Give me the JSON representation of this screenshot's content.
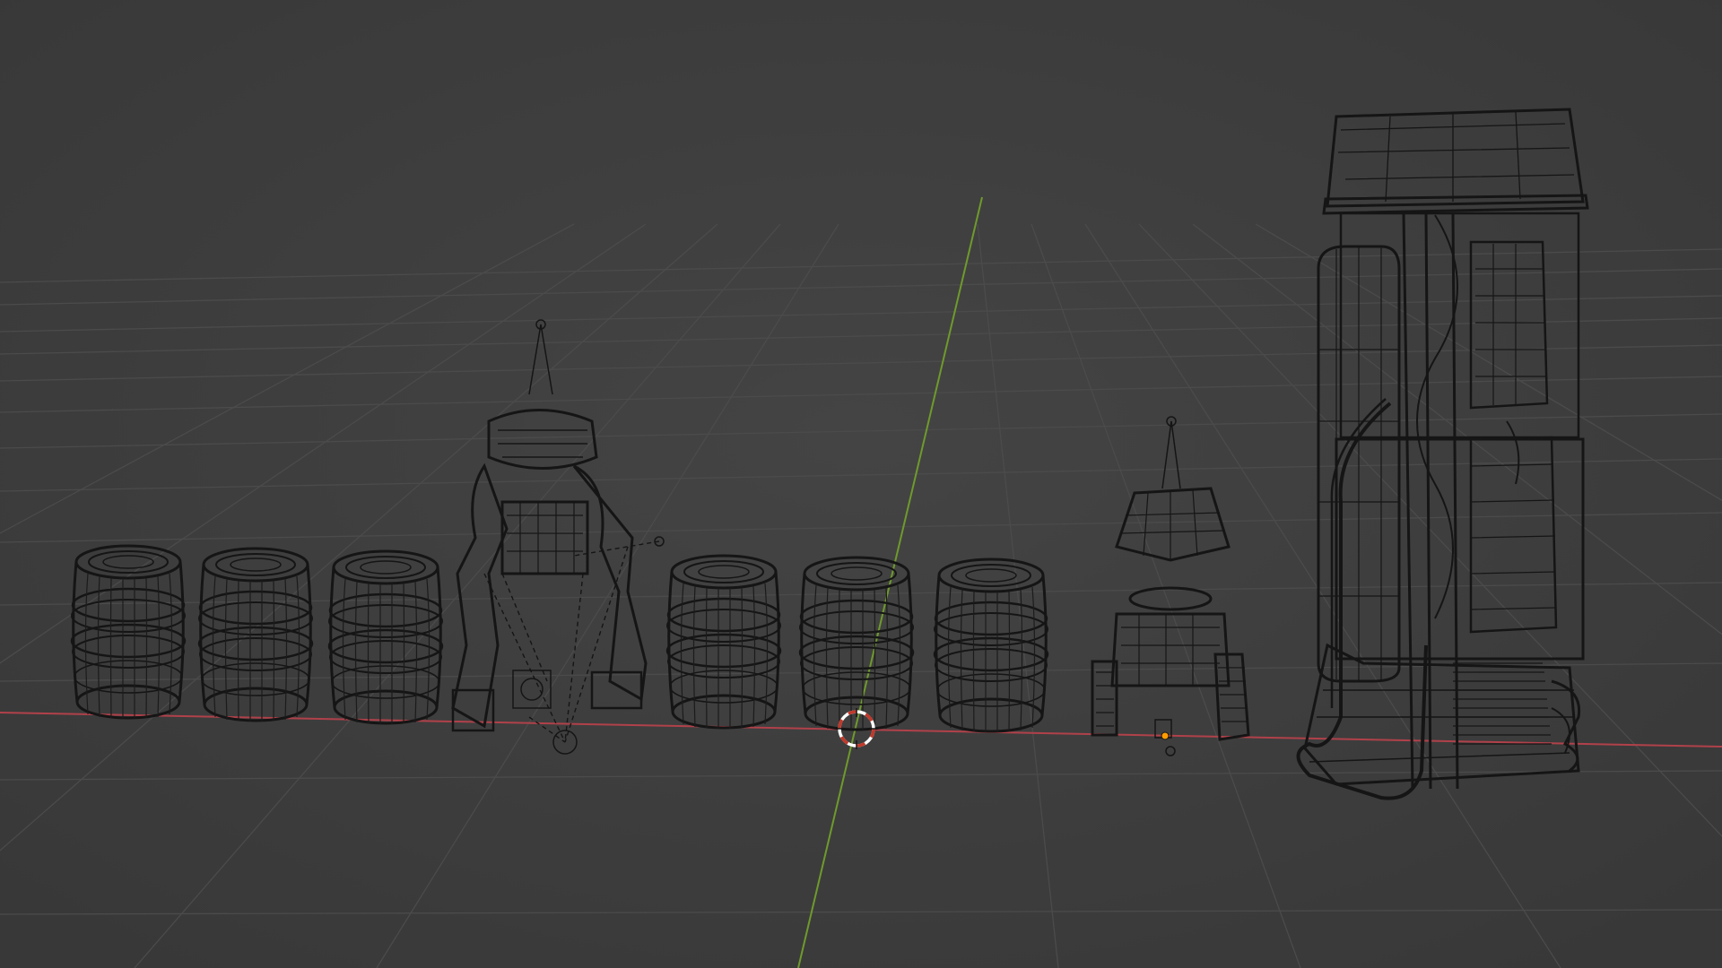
{
  "viewport": {
    "mode": "wireframe",
    "background_color": "#3d3d3d",
    "grid_color": "#4a4a4a",
    "x_axis_color": "#b0414a",
    "y_axis_color": "#6f9a2c",
    "wire_color": "#151515",
    "cursor_colors": [
      "#c0392b",
      "#ffffff"
    ],
    "origin_color": "#ff9d00"
  },
  "objects": [
    {
      "name": "barrel",
      "icon": "barrel-wireframe-icon"
    },
    {
      "name": "barrel",
      "icon": "barrel-wireframe-icon"
    },
    {
      "name": "barrel",
      "icon": "barrel-wireframe-icon"
    },
    {
      "name": "robot-arm-rig",
      "icon": "robot-arm-wireframe-icon"
    },
    {
      "name": "barrel",
      "icon": "barrel-wireframe-icon"
    },
    {
      "name": "barrel",
      "icon": "barrel-wireframe-icon"
    },
    {
      "name": "barrel",
      "icon": "barrel-wireframe-icon"
    },
    {
      "name": "tracked-robot",
      "icon": "tracked-robot-wireframe-icon"
    },
    {
      "name": "fuel-pump",
      "icon": "fuel-pump-wireframe-icon"
    }
  ]
}
